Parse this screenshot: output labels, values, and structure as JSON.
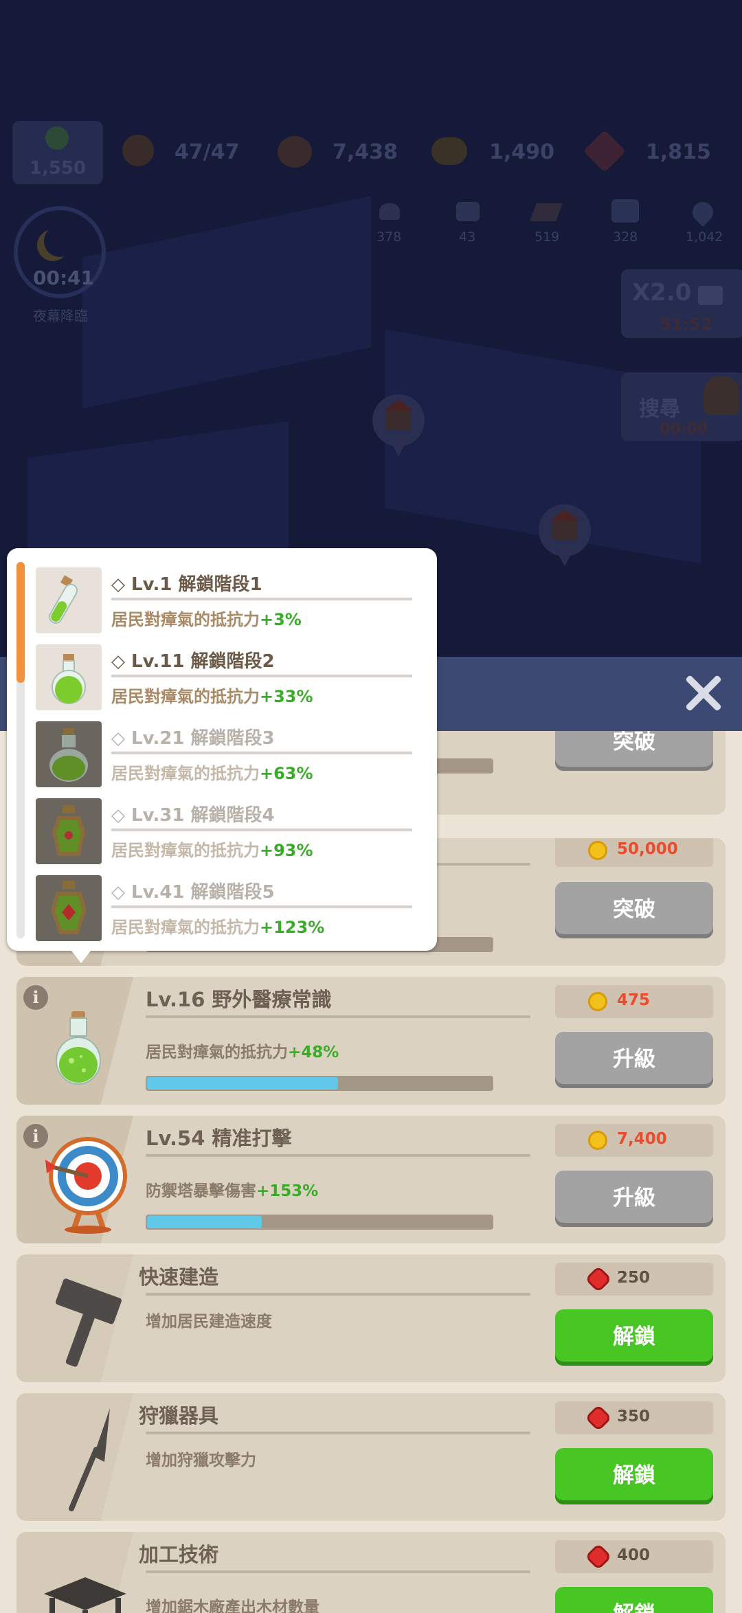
{
  "hud": {
    "level_value": "1,550",
    "population": "47/47",
    "food": "7,438",
    "wood": "1,490",
    "gems": "1,815",
    "resources": [
      "378",
      "43",
      "519",
      "328",
      "1,042"
    ],
    "night_timer": "00:41",
    "night_label": "夜幕降臨",
    "speed_label": "X2.0",
    "speed_timer": "51:52",
    "search_label": "搜尋",
    "search_timer": "00:00"
  },
  "popup": {
    "stages": [
      {
        "title": "Lv.1 解鎖階段1",
        "effect": "居民對瘴氣的抵抗力",
        "bonus": "+3%",
        "unlocked": true,
        "icon": "test-tube-potion-icon"
      },
      {
        "title": "Lv.11 解鎖階段2",
        "effect": "居民對瘴氣的抵抗力",
        "bonus": "+33%",
        "unlocked": true,
        "icon": "round-flask-potion-icon"
      },
      {
        "title": "Lv.21 解鎖階段3",
        "effect": "居民對瘴氣的抵抗力",
        "bonus": "+63%",
        "unlocked": false,
        "icon": "large-flask-potion-icon"
      },
      {
        "title": "Lv.31 解鎖階段4",
        "effect": "居民對瘴氣的抵抗力",
        "bonus": "+93%",
        "unlocked": false,
        "icon": "lantern-bottle-icon"
      },
      {
        "title": "Lv.41 解鎖階段5",
        "effect": "居民對瘴氣的抵抗力",
        "bonus": "+123%",
        "unlocked": false,
        "icon": "jeweled-bottle-icon"
      }
    ]
  },
  "cards": [
    {
      "button": "突破",
      "button_style": "grey",
      "progress": 0.66
    },
    {
      "cost": "50,000",
      "cost_type": "coin",
      "button": "突破",
      "button_style": "grey",
      "progress": 0.66
    },
    {
      "title": "Lv.16 野外醫療常識",
      "desc": "居民對瘴氣的抵抗力",
      "bonus": "+48%",
      "cost": "475",
      "cost_type": "coin",
      "button": "升級",
      "button_style": "grey",
      "progress": 0.55,
      "icon": "green-potion-icon"
    },
    {
      "title": "Lv.54 精准打擊",
      "desc": "防禦塔暴擊傷害",
      "bonus": "+153%",
      "cost": "7,400",
      "cost_type": "coin",
      "button": "升級",
      "button_style": "grey",
      "progress": 0.33,
      "icon": "archery-target-icon"
    },
    {
      "title": "快速建造",
      "desc": "增加居民建造速度",
      "cost": "250",
      "cost_type": "gem",
      "button": "解鎖",
      "button_style": "green",
      "icon": "hammer-icon"
    },
    {
      "title": "狩獵器具",
      "desc": "增加狩獵攻擊力",
      "cost": "350",
      "cost_type": "gem",
      "button": "解鎖",
      "button_style": "green",
      "icon": "spear-icon"
    },
    {
      "title": "加工技術",
      "desc": "增加鋸木廠產出木材數量",
      "cost": "400",
      "cost_type": "gem",
      "button": "解鎖",
      "button_style": "green",
      "icon": "workbench-icon"
    }
  ],
  "colors": {
    "accent_orange": "#f3903b",
    "progress_blue": "#61c8e9",
    "unlock_green": "#48c724",
    "bonus_green": "#3bab2a",
    "cost_red": "#ea4b2c"
  }
}
